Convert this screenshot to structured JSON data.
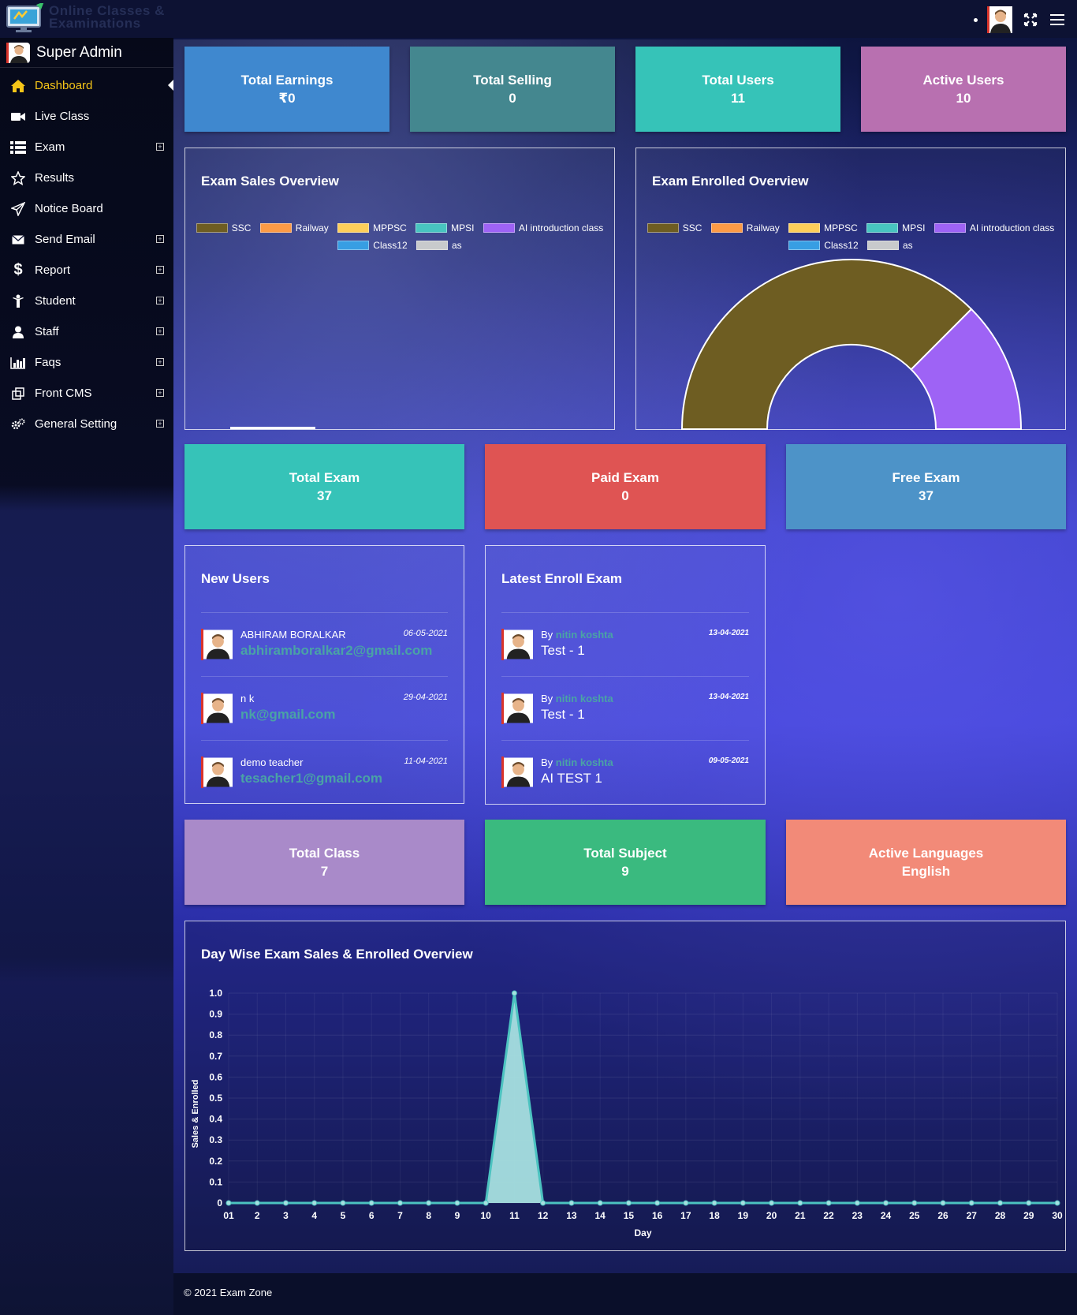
{
  "brand": {
    "logo_text": "Online Classes & Examinations"
  },
  "sidebar": {
    "user_name": "Super Admin",
    "items": [
      {
        "label": "Dashboard",
        "icon": "home-icon",
        "active": true
      },
      {
        "label": "Live Class",
        "icon": "video-icon"
      },
      {
        "label": "Exam",
        "icon": "list-icon",
        "expandable": true
      },
      {
        "label": "Results",
        "icon": "star-icon"
      },
      {
        "label": "Notice Board",
        "icon": "paper-plane-icon"
      },
      {
        "label": "Send Email",
        "icon": "envelope-icon",
        "expandable": true
      },
      {
        "label": "Report",
        "icon": "dollar-icon",
        "expandable": true
      },
      {
        "label": "Student",
        "icon": "student-icon",
        "expandable": true
      },
      {
        "label": "Staff",
        "icon": "user-icon",
        "expandable": true
      },
      {
        "label": "Faqs",
        "icon": "bar-chart-icon",
        "expandable": true
      },
      {
        "label": "Front CMS",
        "icon": "cms-icon",
        "expandable": true
      },
      {
        "label": "General Setting",
        "icon": "gears-icon",
        "expandable": true
      }
    ]
  },
  "stats_top": [
    {
      "label": "Total Earnings",
      "value": "₹0",
      "color": "#3f88cf"
    },
    {
      "label": "Total Selling",
      "value": "0",
      "color": "#44878f"
    },
    {
      "label": "Total Users",
      "value": "11",
      "color": "#36c3b8"
    },
    {
      "label": "Active Users",
      "value": "10",
      "color": "#b870b0"
    }
  ],
  "sales_chart": {
    "title": "Exam Sales Overview",
    "legend": [
      {
        "label": "SSC",
        "color": "#6e5d22"
      },
      {
        "label": "Railway",
        "color": "#fd9b46"
      },
      {
        "label": "MPPSC",
        "color": "#fdce5a"
      },
      {
        "label": "MPSI",
        "color": "#48c4c0"
      },
      {
        "label": "AI introduction class",
        "color": "#9e63f5"
      },
      {
        "label": "Class12",
        "color": "#379ee3"
      },
      {
        "label": "as",
        "color": "#c8cacc"
      }
    ]
  },
  "chart_data": {
    "type": "pie",
    "title": "Exam Enrolled Overview",
    "categories": [
      "SSC",
      "Railway",
      "MPPSC",
      "MPSI",
      "AI introduction class",
      "Class12",
      "as"
    ],
    "values": [
      3,
      0,
      0,
      0,
      1,
      0,
      0
    ],
    "colors": [
      "#6e5d22",
      "#fd9b46",
      "#fdce5a",
      "#48c4c0",
      "#9e63f5",
      "#379ee3",
      "#c8cacc"
    ],
    "legend_position": "top"
  },
  "stats_mid": [
    {
      "label": "Total Exam",
      "value": "37",
      "color": "#36c3b8"
    },
    {
      "label": "Paid Exam",
      "value": "0",
      "color": "#df5453"
    },
    {
      "label": "Free Exam",
      "value": "37",
      "color": "#4d93c8"
    }
  ],
  "new_users": {
    "title": "New Users",
    "rows": [
      {
        "name": "ABHIRAM BORALKAR",
        "email": "abhiramboralkar2@gmail.com",
        "date": "06-05-2021"
      },
      {
        "name": "n k",
        "email": "nk@gmail.com",
        "date": "29-04-2021"
      },
      {
        "name": "demo teacher",
        "email": "tesacher1@gmail.com",
        "date": "11-04-2021"
      }
    ]
  },
  "latest_enroll": {
    "title": "Latest Enroll Exam",
    "by_label": "By",
    "rows": [
      {
        "by": "nitin koshta",
        "exam": "Test - 1",
        "date": "13-04-2021"
      },
      {
        "by": "nitin koshta",
        "exam": "Test - 1",
        "date": "13-04-2021"
      },
      {
        "by": "nitin koshta",
        "exam": "AI TEST 1",
        "date": "09-05-2021"
      }
    ]
  },
  "stats_bottom": [
    {
      "label": "Total Class",
      "value": "7",
      "color": "#a98ac9"
    },
    {
      "label": "Total Subject",
      "value": "9",
      "color": "#3aba7f"
    },
    {
      "label": "Active Languages",
      "value": "English",
      "color": "#f28a78"
    }
  ],
  "day_chart": {
    "title": "Day Wise Exam Sales & Enrolled Overview",
    "type": "area",
    "x_label": "Day",
    "y_label": "Sales & Enrolled",
    "ylim": [
      0,
      1.0
    ],
    "y_ticks": [
      "0",
      "0.1",
      "0.2",
      "0.3",
      "0.4",
      "0.5",
      "0.6",
      "0.7",
      "0.8",
      "0.9",
      "1.0"
    ],
    "x": [
      "01",
      "2",
      "3",
      "4",
      "5",
      "6",
      "7",
      "8",
      "9",
      "10",
      "11",
      "12",
      "13",
      "14",
      "15",
      "16",
      "17",
      "18",
      "19",
      "20",
      "21",
      "22",
      "23",
      "24",
      "25",
      "26",
      "27",
      "28",
      "29",
      "30"
    ],
    "values": [
      0,
      0,
      0,
      0,
      0,
      0,
      0,
      0,
      0,
      0,
      1,
      0,
      0,
      0,
      0,
      0,
      0,
      0,
      0,
      0,
      0,
      0,
      0,
      0,
      0,
      0,
      0,
      0,
      0,
      0
    ],
    "line_color": "#4cc3c0",
    "fill_color": "#a6e0e0"
  },
  "footer": {
    "text": "© 2021 Exam Zone"
  }
}
